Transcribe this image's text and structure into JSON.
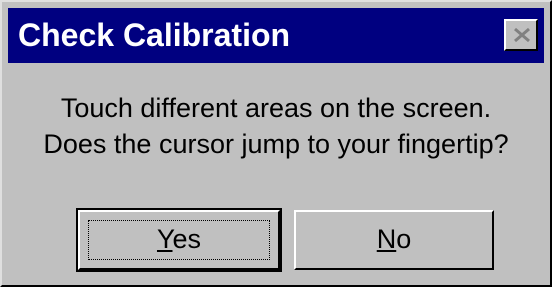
{
  "dialog": {
    "title": "Check Calibration",
    "message_line1": "Touch different areas on the screen.",
    "message_line2": "Does the cursor jump to your fingertip?",
    "yes_accel": "Y",
    "yes_rest": "es",
    "no_accel": "N",
    "no_rest": "o",
    "close_icon": "close-icon",
    "colors": {
      "titlebar": "#000080",
      "face": "#c0c0c0",
      "title_text": "#ffffff"
    }
  }
}
